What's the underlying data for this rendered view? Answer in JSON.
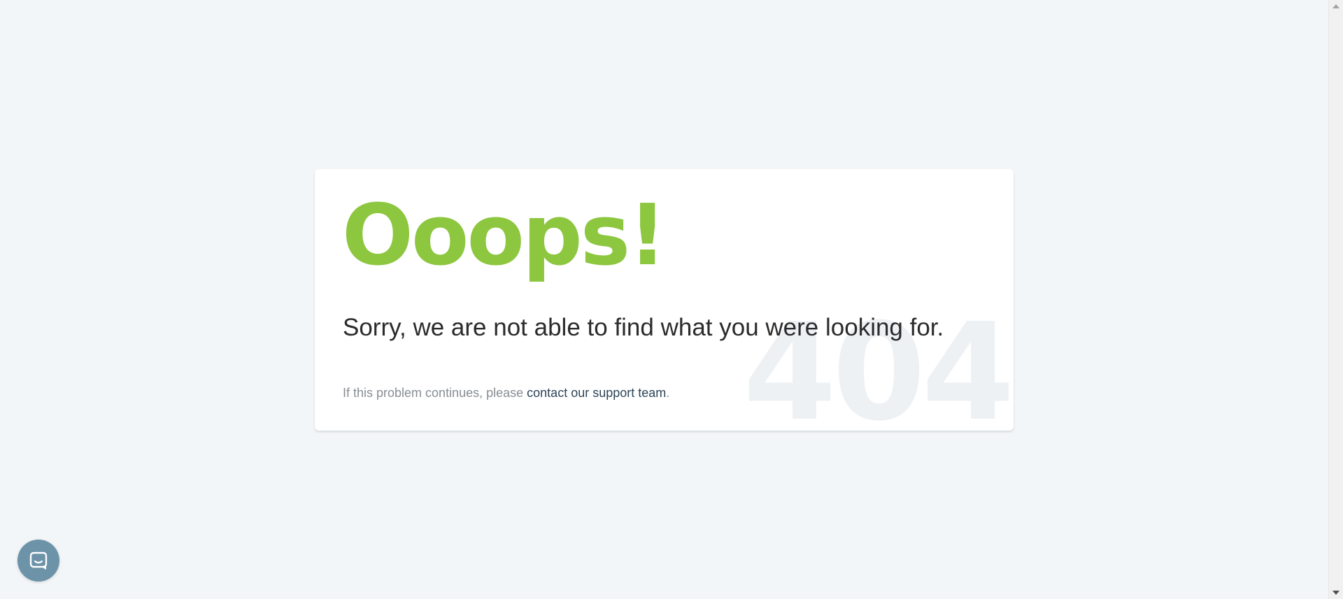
{
  "error": {
    "title": "Ooops!",
    "message": "Sorry, we are not able to find what you were looking for.",
    "background_code": "404",
    "help_prefix": "If this problem continues, please ",
    "help_link": "contact our support team",
    "help_suffix": "."
  },
  "chat_widget": {
    "icon": "chat-bubble-icon"
  },
  "colors": {
    "accent": "#8dc63f",
    "link": "#2d4457",
    "chat_button": "#6d93a8",
    "background": "#f3f6f9"
  }
}
